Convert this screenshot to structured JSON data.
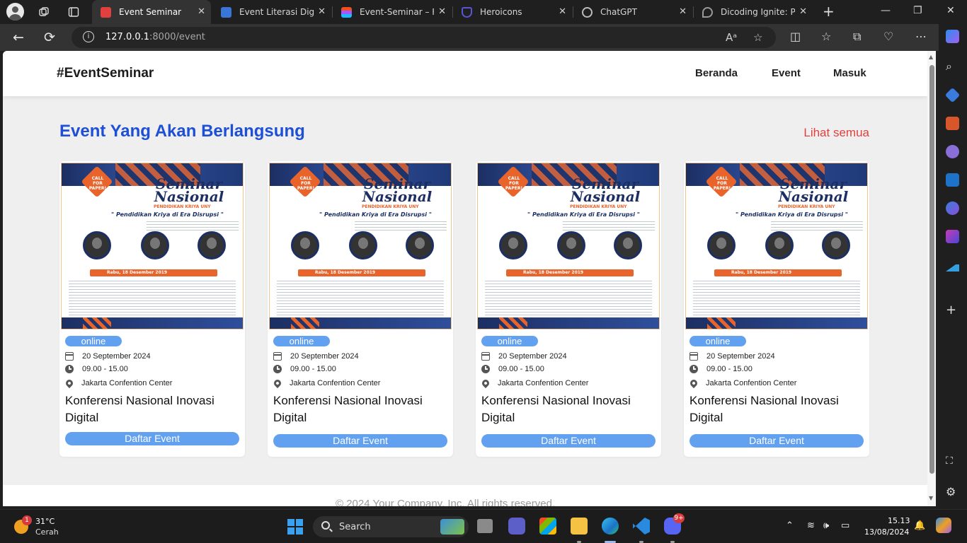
{
  "browser": {
    "tabs": [
      {
        "title": "Event Seminar",
        "favicon_color": "#e0413e",
        "active": true
      },
      {
        "title": "Event Literasi Digital",
        "favicon_color": "#3a76d8",
        "active": false
      },
      {
        "title": "Event-Seminar – Figma",
        "favicon_color": "#f24e1e",
        "active": false
      },
      {
        "title": "Heroicons",
        "favicon_color": "#5b54d6",
        "active": false
      },
      {
        "title": "ChatGPT",
        "favicon_color": "#9a9a9a",
        "active": false
      },
      {
        "title": "Dicoding Ignite: Pathway",
        "favicon_color": "#9a9a9a",
        "active": false
      }
    ],
    "close_glyph": "✕",
    "new_tab_glyph": "+",
    "url_host": "127.0.0.1",
    "url_rest": ":8000/event"
  },
  "page": {
    "brand": "#EventSeminar",
    "nav": [
      "Beranda",
      "Event",
      "Masuk"
    ],
    "section_title": "Event Yang Akan Berlangsung",
    "see_all": "Lihat semua",
    "footer": "© 2024 Your Company, Inc. All rights reserved.",
    "poster": {
      "call_for_paper": "CALL FOR PAPER!",
      "title": "Seminar Nasional",
      "subtitle": "PENDIDIKAN KRIYA UNY",
      "theme": "\" Pendidikan Kriya di Era Disrupsi \"",
      "date": "Rabu, 18 Desember 2019"
    },
    "events": [
      {
        "mode": "online",
        "date": "20 September 2024",
        "time": "09.00 - 15.00",
        "location": "Jakarta Confention Center",
        "title": "Konferensi Nasional Inovasi Digital",
        "button": "Daftar Event"
      },
      {
        "mode": "online",
        "date": "20 September 2024",
        "time": "09.00 - 15.00",
        "location": "Jakarta Confention Center",
        "title": "Konferensi Nasional Inovasi Digital",
        "button": "Daftar Event"
      },
      {
        "mode": "online",
        "date": "20 September 2024",
        "time": "09.00 - 15.00",
        "location": "Jakarta Confention Center",
        "title": "Konferensi Nasional Inovasi Digital",
        "button": "Daftar Event"
      },
      {
        "mode": "online",
        "date": "20 September 2024",
        "time": "09.00 - 15.00",
        "location": "Jakarta Confention Center",
        "title": "Konferensi Nasional Inovasi Digital",
        "button": "Daftar Event"
      }
    ]
  },
  "taskbar": {
    "weather_temp": "31°C",
    "weather_desc": "Cerah",
    "weather_badge": "1",
    "search_label": "Search",
    "discord_badge": "9+",
    "time": "15.13",
    "date": "13/08/2024"
  },
  "colors": {
    "accent_blue": "#1d4fd7",
    "link_red": "#e0413e",
    "button_blue": "#62a0f0"
  }
}
